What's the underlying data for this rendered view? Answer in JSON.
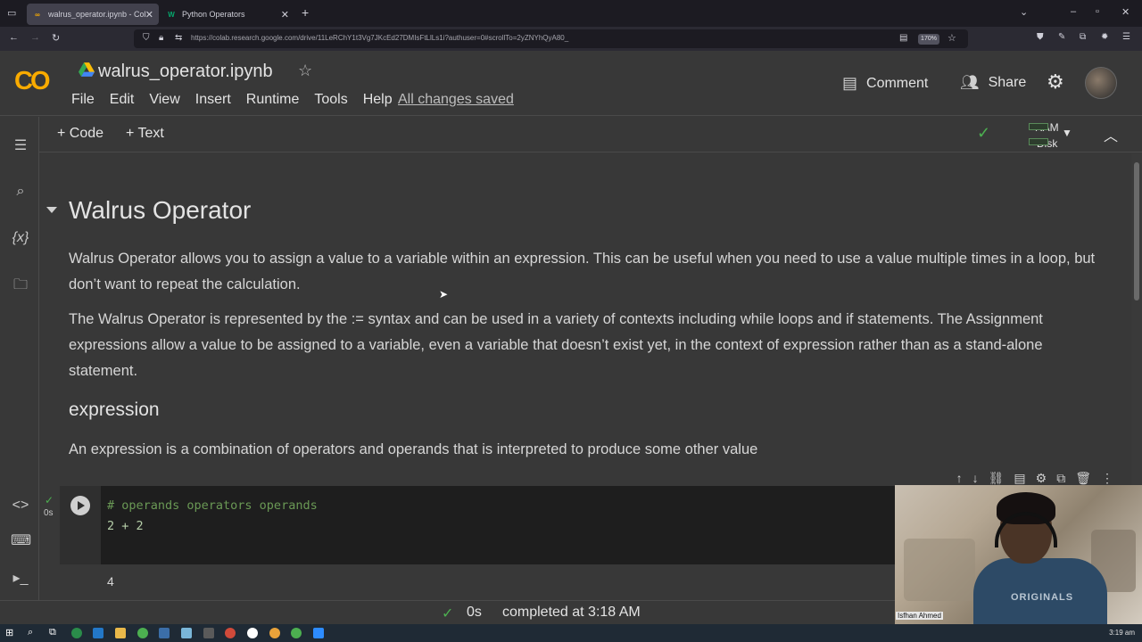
{
  "browser": {
    "tabs": [
      {
        "label": "walrus_operator.ipynb - Colab",
        "icon": "colab-icon",
        "active": true
      },
      {
        "label": "Python Operators",
        "icon": "w3schools-icon",
        "active": false
      }
    ],
    "new_tab": "+",
    "url": "https://colab.research.google.com/drive/11LeRChY1t3Vg7JKcEd27DMIsFtLlLs1i?authuser=0#scrollTo=2yZNYhQyA80_",
    "zoom": "170%"
  },
  "header": {
    "logo": "CO",
    "notebook_title": "walrus_operator.ipynb",
    "menu": [
      "File",
      "Edit",
      "View",
      "Insert",
      "Runtime",
      "Tools",
      "Help"
    ],
    "save_status": "All changes saved",
    "comment_label": "Comment",
    "share_label": "Share"
  },
  "toolbar": {
    "add_code": "Code",
    "add_text": "Text",
    "ram_label": "RAM",
    "disk_label": "Disk"
  },
  "notebook": {
    "heading": "Walrus Operator",
    "para1": "Walrus Operator allows you to assign a value to a variable within an expression. This can be useful when you need to use a value multiple times in a loop, but don’t want to repeat the calculation.",
    "para2": "The Walrus Operator is represented by the := syntax and can be used in a variety of contexts including while loops and if statements. The Assignment expressions allow a value to be assigned to a variable, even a variable that doesn’t exist yet, in the context of expression rather than as a stand-alone statement.",
    "subheading": "expression",
    "para3": "An expression is a combination of operators and operands that is interpreted to produce some other value",
    "code_cell": {
      "line1": "# operands operators operands",
      "line2": "2 + 2",
      "exec_time": "0s",
      "output": "4"
    }
  },
  "statusbar": {
    "duration": "0s",
    "message": "completed at 3:18 AM"
  },
  "taskbar": {
    "clock": "3:19 am"
  },
  "webcam": {
    "name": "Isfhan Ahmed",
    "shirt": "ORIGINALS"
  },
  "colors": {
    "accent_green": "#4caf50",
    "colab_orange": "#f9ab00",
    "comment_green": "#6a9955",
    "number_green": "#b5cea8"
  }
}
